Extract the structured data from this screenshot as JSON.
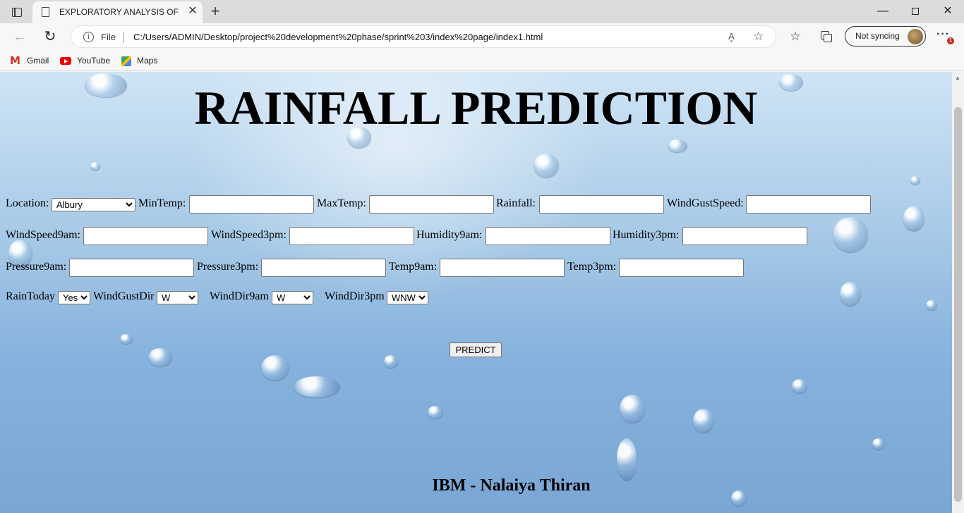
{
  "browser": {
    "tab_title": "EXPLORATORY ANALYSIS OF RAINFALL",
    "address_scheme_label": "File",
    "url": "C:/Users/ADMIN/Desktop/project%20development%20phase/sprint%203/index%20page/index1.html",
    "read_aloud_label": "A͓",
    "profile_label": "Not syncing",
    "notification_count": "1",
    "bookmarks": [
      "Gmail",
      "YouTube",
      "Maps"
    ]
  },
  "page": {
    "title": "RAINFALL PREDICTION",
    "footer": "IBM - Nalaiya Thiran",
    "predict_button": "PREDICT",
    "labels": {
      "location": "Location:",
      "min_temp": "MinTemp:",
      "max_temp": "MaxTemp:",
      "rainfall": "Rainfall:",
      "wind_gust_speed": "WindGustSpeed:",
      "wind_speed_9am": "WindSpeed9am:",
      "wind_speed_3pm": "WindSpeed3pm:",
      "humidity_9am": "Humidity9am:",
      "humidity_3pm": "Humidity3pm:",
      "pressure_9am": "Pressure9am:",
      "pressure_3pm": "Pressure3pm:",
      "temp_9am": "Temp9am:",
      "temp_3pm": "Temp3pm:",
      "rain_today": "RainToday",
      "wind_gust_dir": "WindGustDir",
      "wind_dir_9am": "WindDir9am",
      "wind_dir_3pm": "WindDir3pm"
    },
    "selects": {
      "location": "Albury",
      "rain_today": "Yes",
      "wind_gust_dir": "W",
      "wind_dir_9am": "W",
      "wind_dir_3pm": "WNW"
    }
  }
}
